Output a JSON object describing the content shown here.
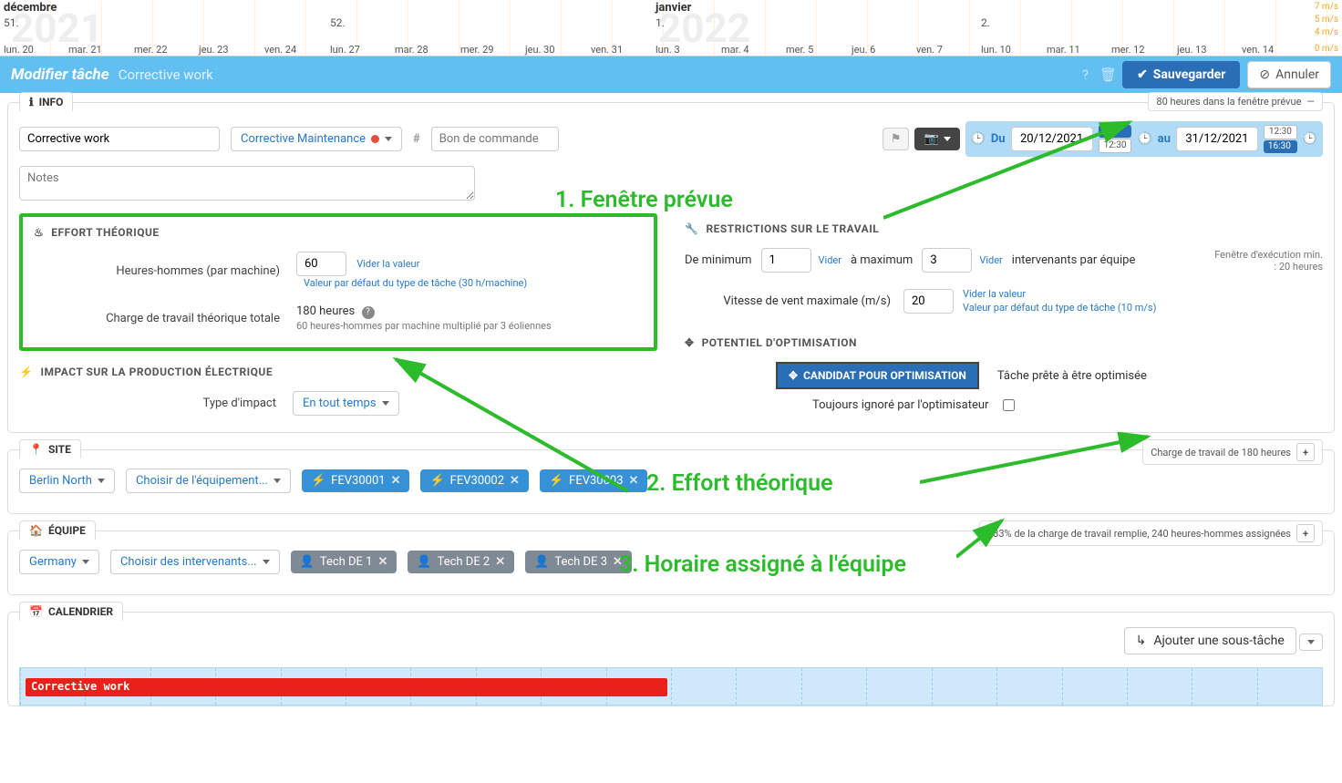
{
  "timeline": {
    "year1": "2021",
    "year2": "2022",
    "month1": "décembre",
    "month2": "janvier",
    "weeks": [
      "51.",
      "52.",
      "1.",
      "2."
    ],
    "days": [
      "lun. 20",
      "mar. 21",
      "mer. 22",
      "jeu. 23",
      "ven. 24",
      "lun. 27",
      "mar. 28",
      "mer. 29",
      "jeu. 30",
      "ven. 31",
      "lun. 3",
      "mar. 4",
      "mer. 5",
      "jeu. 6",
      "ven. 7",
      "lun. 10",
      "mar. 11",
      "mer. 12",
      "jeu. 13",
      "ven. 14"
    ],
    "winds": [
      "7 m/s",
      "5 m/s",
      "4 m/s",
      "0 m/s"
    ]
  },
  "header": {
    "edit": "Modifier tâche",
    "title": "Corrective work",
    "save": "Sauvegarder",
    "cancel": "Annuler"
  },
  "info": {
    "tab": "INFO",
    "rightTab": "80 heures dans la fenêtre prévue",
    "nameValue": "Corrective work",
    "category": "Corrective Maintenance",
    "poPlaceholder": "Bon de commande",
    "notesPlaceholder": "Notes",
    "du": "Du",
    "au": "au",
    "dateFrom": "20/12/2021",
    "dateTo": "31/12/2021",
    "timeFromTop": "",
    "timeFromBot": "12:30",
    "timeToTop": "12:30",
    "timeToBot": "16:30"
  },
  "effort": {
    "title": "EFFORT THÉORIQUE",
    "hhLabel": "Heures-hommes (par machine)",
    "hhValue": "60",
    "clear": "Vider la valeur",
    "default": "Valeur par défaut du type de tâche (30 h/machine)",
    "totalLabel": "Charge de travail théorique totale",
    "totalValue": "180 heures",
    "totalHint": "60 heures-hommes par machine multiplié par 3 éoliennes"
  },
  "impact": {
    "title": "IMPACT SUR LA PRODUCTION ÉLECTRIQUE",
    "typeLabel": "Type d'impact",
    "typeValue": "En tout temps"
  },
  "restrictions": {
    "title": "RESTRICTIONS SUR LE TRAVAIL",
    "minLabel": "De minimum",
    "min": "1",
    "maxLabel": "à maximum",
    "max": "3",
    "clear": "Vider",
    "teamLabel": "intervenants par équipe",
    "execWindowLabel": "Fenêtre d'exécution min. : 20 heures",
    "windLabel": "Vitesse de vent maximale (m/s)",
    "wind": "20",
    "windClear": "Vider la valeur",
    "windDefault": "Valeur par défaut du type de tâche (10 m/s)"
  },
  "opt": {
    "title": "POTENTIEL D'OPTIMISATION",
    "badge": "CANDIDAT POUR OPTIMISATION",
    "ready": "Tâche prête à être optimisée",
    "ignore": "Toujours ignoré par l'optimisateur"
  },
  "site": {
    "tab": "SITE",
    "rightTab": "Charge de travail de 180 heures",
    "site": "Berlin North",
    "choose": "Choisir de l'équipement...",
    "eq": [
      "FEV30001",
      "FEV30002",
      "FEV30003"
    ]
  },
  "team": {
    "tab": "ÉQUIPE",
    "rightTab": "133% de la charge de travail remplie, 240 heures-hommes assignées",
    "country": "Germany",
    "choose": "Choisir des intervenants...",
    "techs": [
      "Tech DE 1",
      "Tech DE 2",
      "Tech DE 3"
    ]
  },
  "calendar": {
    "tab": "CALENDRIER",
    "addSub": "Ajouter une sous-tâche",
    "task": "Corrective work"
  },
  "annotations": {
    "a1": "1. Fenêtre prévue",
    "a2": "2. Effort théorique",
    "a3": "3. Horaire assigné à l'équipe"
  }
}
